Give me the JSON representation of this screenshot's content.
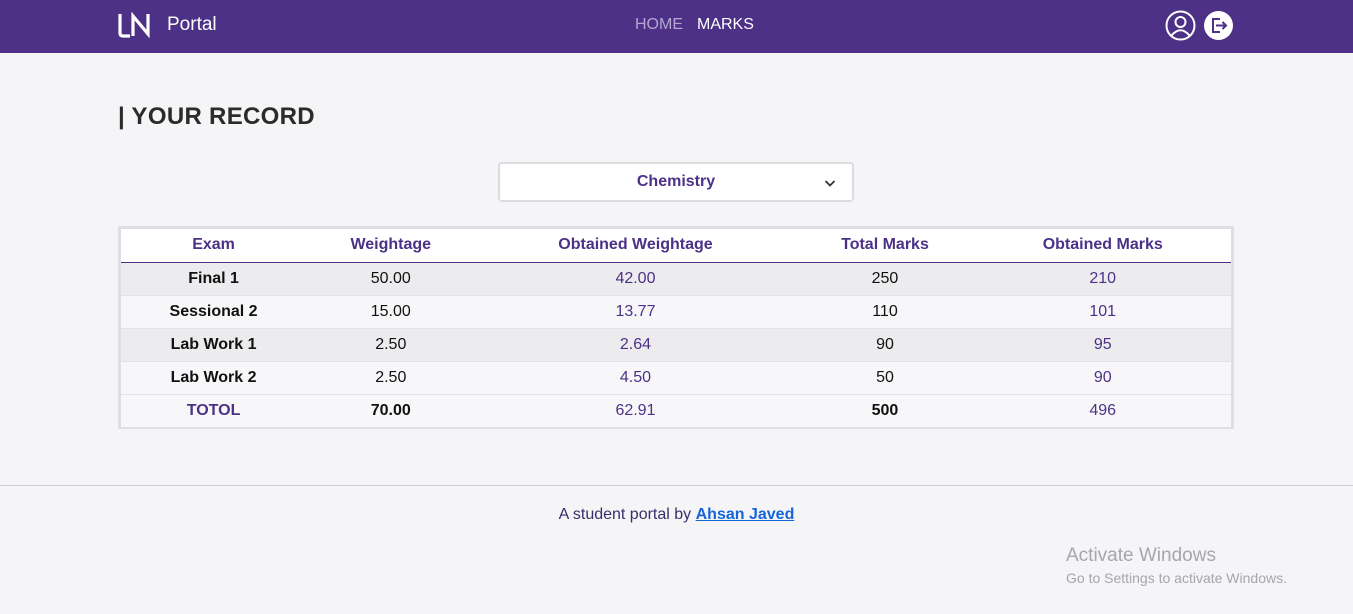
{
  "navbar": {
    "brand_text": "Portal",
    "links": [
      {
        "label": "HOME",
        "active": false
      },
      {
        "label": "MARKS",
        "active": true
      }
    ],
    "icons": [
      "user-icon",
      "logout-icon"
    ]
  },
  "page": {
    "title": "| YOUR RECORD"
  },
  "subject_select": {
    "value": "Chemistry"
  },
  "table": {
    "headers": [
      "Exam",
      "Weightage",
      "Obtained Weightage",
      "Total Marks",
      "Obtained Marks"
    ],
    "rows": [
      {
        "exam": "Final 1",
        "weightage": "50.00",
        "obtained_weightage": "42.00",
        "total_marks": "250",
        "obtained_marks": "210"
      },
      {
        "exam": "Sessional 2",
        "weightage": "15.00",
        "obtained_weightage": "13.77",
        "total_marks": "110",
        "obtained_marks": "101"
      },
      {
        "exam": "Lab Work 1",
        "weightage": "2.50",
        "obtained_weightage": "2.64",
        "total_marks": "90",
        "obtained_marks": "95"
      },
      {
        "exam": "Lab Work 2",
        "weightage": "2.50",
        "obtained_weightage": "4.50",
        "total_marks": "50",
        "obtained_marks": "90"
      }
    ],
    "total": {
      "exam": "TOTOL",
      "weightage": "70.00",
      "obtained_weightage": "62.91",
      "total_marks": "500",
      "obtained_marks": "496"
    }
  },
  "footer": {
    "text": "A student portal by ",
    "link_text": "Ahsan Javed"
  },
  "watermark": {
    "line1": "Activate Windows",
    "line2": "Go to Settings to activate Windows."
  },
  "colors": {
    "navbar": "#4c3187",
    "accent": "#4c3187",
    "link": "#1565d8"
  }
}
